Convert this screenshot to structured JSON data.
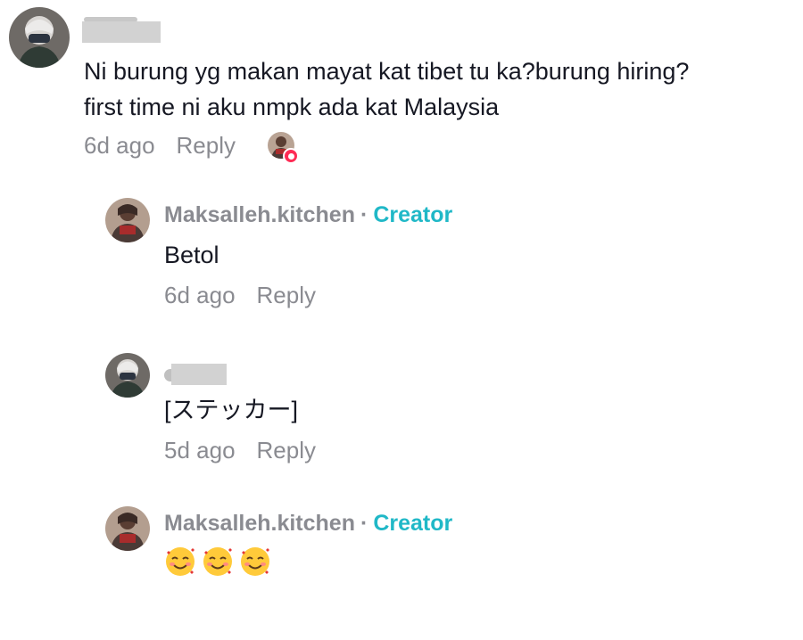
{
  "main_comment": {
    "username": "",
    "text_line1": "Ni burung yg makan mayat kat tibet tu ka?burung hiring?",
    "text_line2": "first time ni aku nmpk ada kat Malaysia",
    "time": "6d ago",
    "reply_label": "Reply",
    "creator_liked_icon": "creator-liked-heart-icon"
  },
  "replies": [
    {
      "username": "Maksalleh.kitchen",
      "separator": "·",
      "badge": "Creator",
      "text": "Betol",
      "time": "6d ago",
      "reply_label": "Reply"
    },
    {
      "username": "",
      "text": "[ステッカー]",
      "time": "5d ago",
      "reply_label": "Reply"
    },
    {
      "username": "Maksalleh.kitchen",
      "separator": "·",
      "badge": "Creator",
      "emojis": [
        "smiling-face-with-hearts-emoji",
        "smiling-face-with-hearts-emoji",
        "smiling-face-with-hearts-emoji"
      ]
    }
  ],
  "colors": {
    "text_primary": "#161823",
    "text_secondary": "#8a8b91",
    "creator_badge": "#20b8c7",
    "like_badge": "#fe2c55",
    "redaction": "#d2d2d2"
  }
}
